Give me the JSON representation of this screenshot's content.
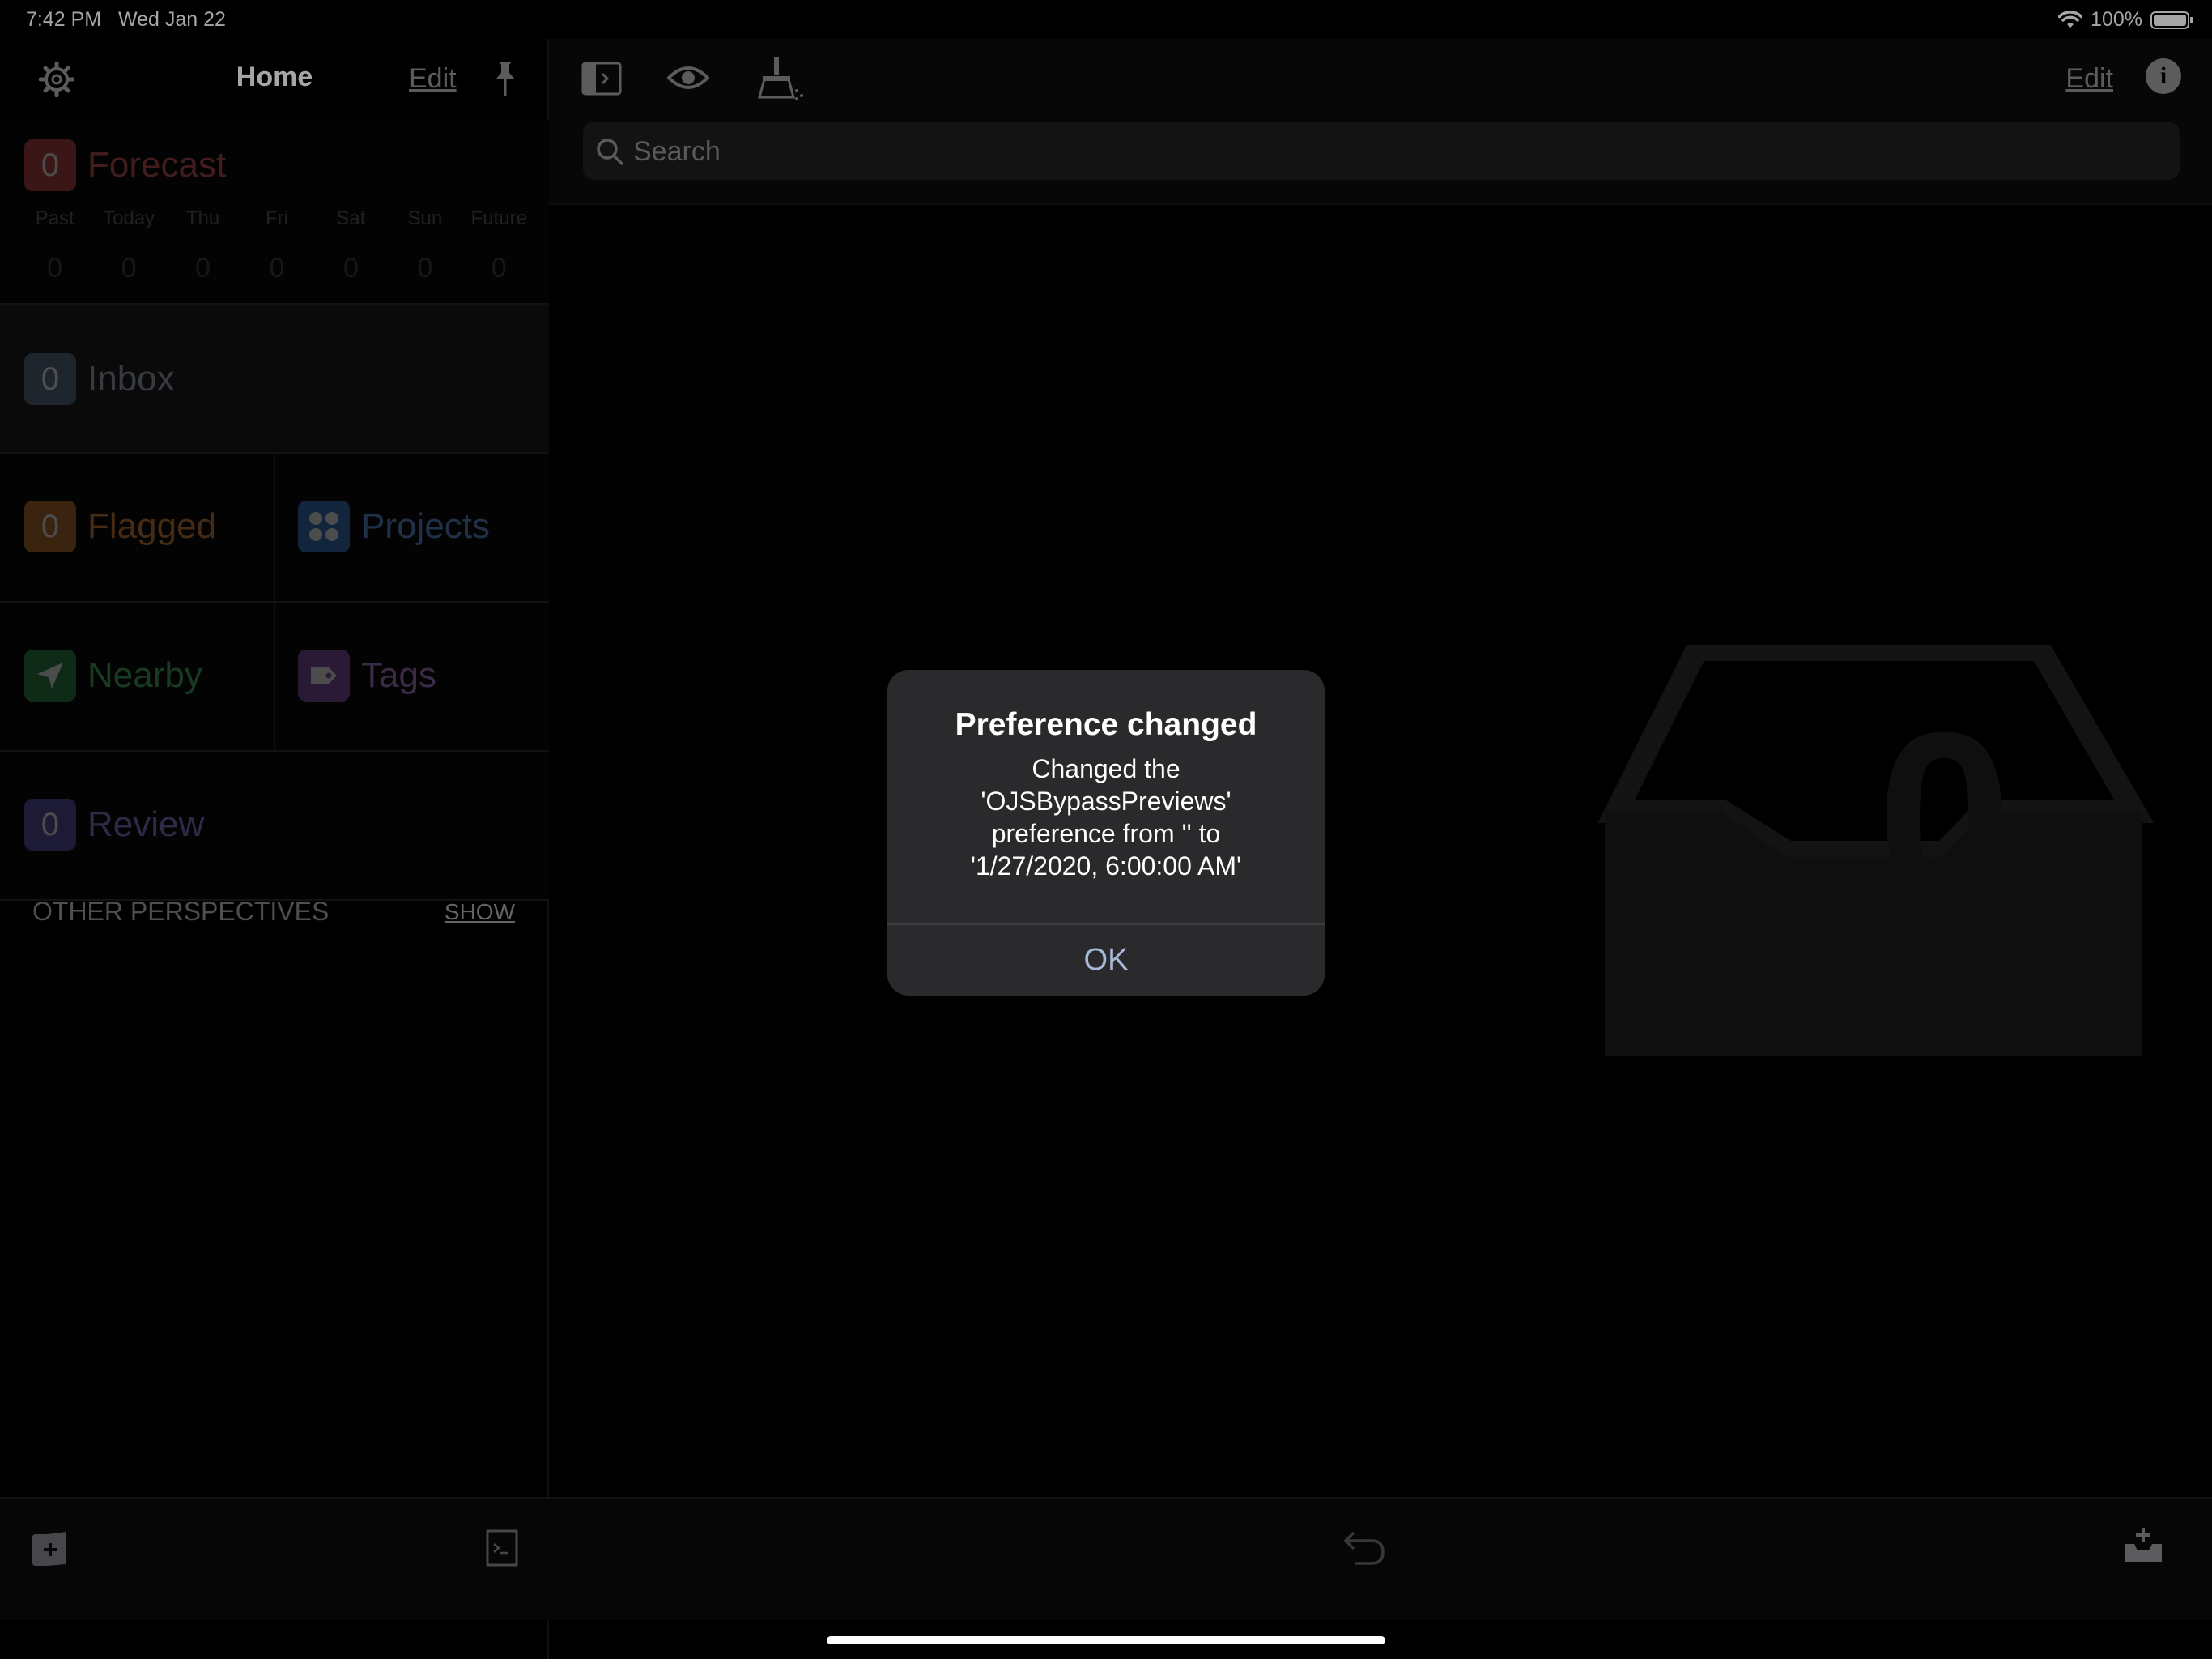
{
  "status_bar": {
    "time": "7:42 PM",
    "date": "Wed Jan 22",
    "battery": "100%"
  },
  "sidebar": {
    "title": "Home",
    "edit_label": "Edit",
    "forecast": {
      "label": "Forecast",
      "count": "0",
      "color": "#c0464b",
      "days": [
        "Past",
        "Today",
        "Thu",
        "Fri",
        "Sat",
        "Sun",
        "Future"
      ],
      "counts": [
        "0",
        "0",
        "0",
        "0",
        "0",
        "0",
        "0"
      ]
    },
    "inbox": {
      "label": "Inbox",
      "count": "0",
      "color": "#5b6b86"
    },
    "flagged": {
      "label": "Flagged",
      "count": "0",
      "color": "#c07230"
    },
    "projects": {
      "label": "Projects",
      "color": "#3a78c8"
    },
    "nearby": {
      "label": "Nearby",
      "color": "#2f8a4a"
    },
    "tags": {
      "label": "Tags",
      "color": "#8a55b0"
    },
    "review": {
      "label": "Review",
      "count": "0",
      "color": "#5a55b0"
    },
    "other_perspectives": "OTHER PERSPECTIVES",
    "show_label": "SHOW"
  },
  "main": {
    "edit_label": "Edit",
    "search_placeholder": "Search",
    "empty_count": "0"
  },
  "alert": {
    "title": "Preference changed",
    "message_line1": "Changed the",
    "message_line2": "'OJSBypassPreviews'",
    "message_line3": "preference from '' to",
    "message_line4": "'1/27/2020, 6:00:00 AM'",
    "ok_label": "OK"
  }
}
